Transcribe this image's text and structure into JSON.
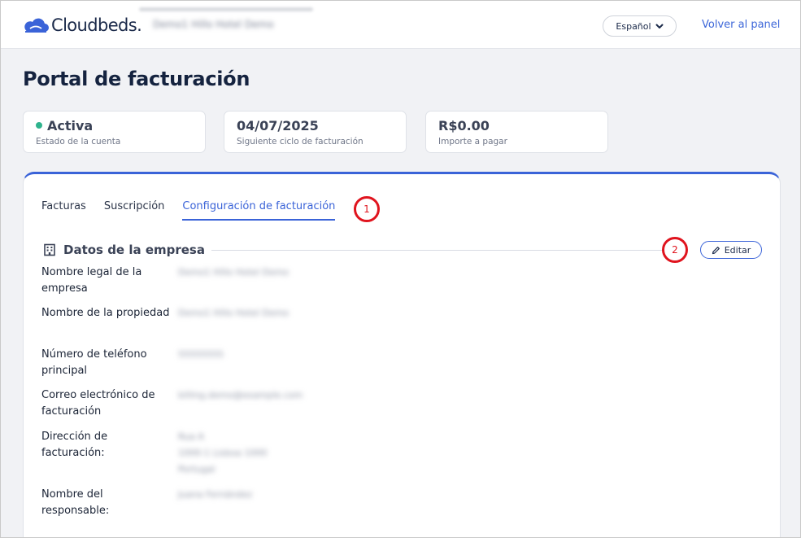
{
  "header": {
    "logo_text": "Cloudbeds",
    "property_name": "Demo1 Hillo Hotel Demo",
    "language": "Español",
    "back_link": "Volver al panel"
  },
  "page": {
    "title": "Portal de facturación"
  },
  "summary_cards": [
    {
      "value": "Activa",
      "label": "Estado de la cuenta",
      "status_color": "#2fb38d"
    },
    {
      "value": "04/07/2025",
      "label": "Siguiente ciclo de facturación"
    },
    {
      "value": "R$0.00",
      "label": "Importe a pagar"
    }
  ],
  "tabs": [
    {
      "label": "Facturas",
      "active": false
    },
    {
      "label": "Suscripción",
      "active": false
    },
    {
      "label": "Configuración de facturación",
      "active": true
    }
  ],
  "markers": [
    "1",
    "2"
  ],
  "company_section": {
    "title": "Datos de la empresa",
    "edit_label": "Editar",
    "fields": [
      {
        "label": "Nombre legal de la empresa",
        "value": "Demo1 Hillo Hotel Demo"
      },
      {
        "label": "Nombre de la propiedad",
        "value": "Demo1 Hillo Hotel Demo"
      },
      {
        "label": "Número de teléfono principal",
        "value": "55555555"
      },
      {
        "label": "Correo electrónico de facturación",
        "value": "billing.demo@example.com"
      },
      {
        "label": "Dirección de facturación:",
        "value_lines": [
          "Rua A",
          "1000-1 Lisboa 1000",
          "Portugal"
        ]
      },
      {
        "label": "Nombre del responsable:",
        "value": "Juana Fernández"
      }
    ]
  },
  "colors": {
    "accent": "#3a63d8",
    "annotation": "#e0141e",
    "status_active": "#2fb38d"
  }
}
